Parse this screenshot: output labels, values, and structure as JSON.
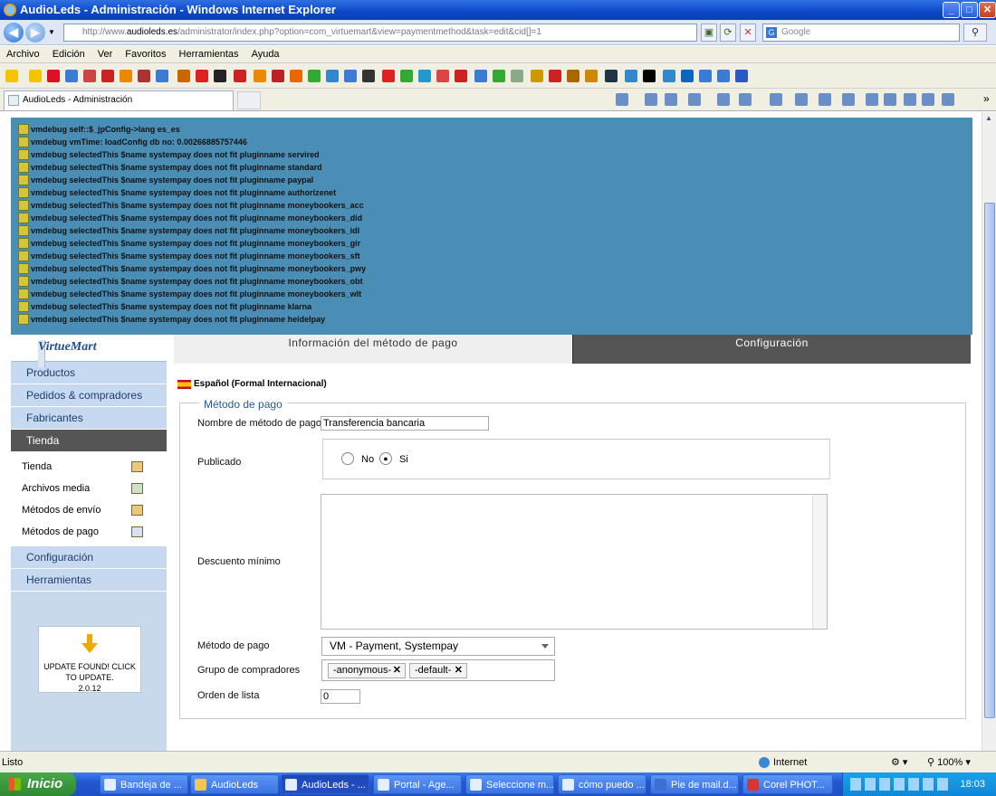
{
  "window": {
    "title": "AudioLeds - Administración - Windows Internet Explorer"
  },
  "address": {
    "prefix": "http://www.",
    "host": "audioleds.es",
    "path": "/administrator/index.php?option=com_virtuemart&view=paymentmethod&task=edit&cid[]=1"
  },
  "search": {
    "placeholder": "Google"
  },
  "menu": [
    "Archivo",
    "Edición",
    "Ver",
    "Favoritos",
    "Herramientas",
    "Ayuda"
  ],
  "browser_tab": {
    "label": "AudioLeds - Administración"
  },
  "debug_lines": [
    "vmdebug self::$_jpConfig->lang es_es",
    "vmdebug vmTime: loadConfig db no: 0.00266885757446",
    "vmdebug selectedThis $name systempay does not fit pluginname servired",
    "vmdebug selectedThis $name systempay does not fit pluginname standard",
    "vmdebug selectedThis $name systempay does not fit pluginname paypal",
    "vmdebug selectedThis $name systempay does not fit pluginname authorizenet",
    "vmdebug selectedThis $name systempay does not fit pluginname moneybookers_acc",
    "vmdebug selectedThis $name systempay does not fit pluginname moneybookers_did",
    "vmdebug selectedThis $name systempay does not fit pluginname moneybookers_idl",
    "vmdebug selectedThis $name systempay does not fit pluginname moneybookers_gir",
    "vmdebug selectedThis $name systempay does not fit pluginname moneybookers_sft",
    "vmdebug selectedThis $name systempay does not fit pluginname moneybookers_pwy",
    "vmdebug selectedThis $name systempay does not fit pluginname moneybookers_obt",
    "vmdebug selectedThis $name systempay does not fit pluginname moneybookers_wlt",
    "vmdebug selectedThis $name systempay does not fit pluginname klarna",
    "vmdebug selectedThis $name systempay does not fit pluginname heidelpay"
  ],
  "sidebar": {
    "logo": "VirtueMart",
    "items": [
      "Productos",
      "Pedidos & compradores",
      "Fabricantes",
      "Tienda"
    ],
    "subitems": [
      "Tienda",
      "Archivos media",
      "Métodos de envío",
      "Métodos de pago"
    ],
    "items_after": [
      "Configuración",
      "Herramientas"
    ],
    "update_label": "UPDATE FOUND! CLICK TO UPDATE.",
    "update_version": "2.0.12"
  },
  "tabs": {
    "info": "Información del método de pago",
    "config": "Configuración"
  },
  "language": "Español (Formal Internacional)",
  "form": {
    "legend": "Método de pago",
    "name_label": "Nombre de método de pago",
    "name_value": "Transferencia bancaria",
    "published_label": "Publicado",
    "radio_no": "No",
    "radio_si": "Si",
    "published_selected": "Si",
    "discount_label": "Descuento mínimo",
    "method_label": "Método de pago",
    "method_value": "VM - Payment, Systempay",
    "groups_label": "Grupo de compradores",
    "groups": [
      "-anonymous-",
      "-default-"
    ],
    "order_label": "Orden de lista",
    "order_value": "0"
  },
  "status": {
    "text": "Listo",
    "zone": "Internet",
    "zoom": "100%"
  },
  "taskbar": {
    "start": "Inicio",
    "tasks": [
      "Bandeja de ...",
      "AudioLeds",
      "AudioLeds - ...",
      "Portal - Age...",
      "Seleccione m...",
      "cómo puedo ...",
      "Pie de mail.d...",
      "Corel PHOT..."
    ],
    "active_task": 2,
    "clock": "18:03"
  }
}
